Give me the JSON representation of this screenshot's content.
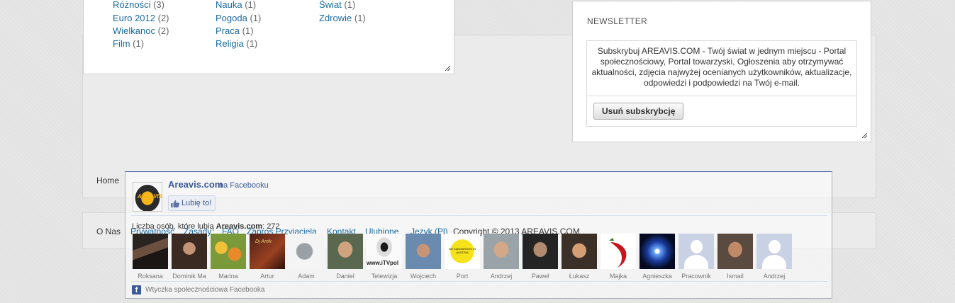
{
  "tags": [
    {
      "label": "Różności",
      "count": "(3)"
    },
    {
      "label": "Euro 2012",
      "count": "(2)"
    },
    {
      "label": "Wielkanoc",
      "count": "(2)"
    },
    {
      "label": "Film",
      "count": "(1)"
    },
    {
      "label": "Nauka",
      "count": "(1)"
    },
    {
      "label": "Pogoda",
      "count": "(1)"
    },
    {
      "label": "Praca",
      "count": "(1)"
    },
    {
      "label": "Religia",
      "count": "(1)"
    },
    {
      "label": "Świat",
      "count": "(1)"
    },
    {
      "label": "Zdrowie",
      "count": "(1)"
    }
  ],
  "newsletter": {
    "title": "NEWSLETTER",
    "text": "Subskrybuj AREAVIS.COM - Twój świat w jednym miejscu - Portal społecznościowy, Portal towarzyski, Ogłoszenia aby otrzymywać aktualności, zdjęcia najwyżej ocenianych użytkowników, aktualizacje, odpowiedzi i podpowiedzi na Twój e-mail.",
    "button": "Usuń subskrybcję"
  },
  "footer": {
    "home": "Home",
    "onas": "O Nas",
    "nav": [
      "Prywatność",
      "Zasady",
      "FAQ",
      "Zaproś Przyjaciela",
      "Kontakt",
      "Ulubione",
      "Język (Pl)"
    ],
    "copyright": "Copyright © 2013 AREAVIS.COM"
  },
  "facebook": {
    "logo_text": "AREAVIS",
    "page_name": "Areavis.com",
    "on_facebook": "na Facebooku",
    "like_label": "Lubię to!",
    "count_prefix": "Liczba osób, które lubią",
    "count_page": "Areavis.com",
    "count_value": ": 272",
    "fans": [
      "Roksana",
      "Dominik Ma",
      "Marina",
      "Artur",
      "Adam",
      "Daniel",
      "Telewizja",
      "Wojciech",
      "Port",
      "Andrzej",
      "Paweł",
      "Łukasz",
      "Majka",
      "Agnieszka",
      "Pracownik",
      "Ismail",
      "Andrzej"
    ],
    "fan_thumb_texts": {
      "artur": "Dj Arek",
      "telewizja": "www.iTVpol",
      "port": "NO KANGAROOS IN AUSTRIA"
    },
    "plugin_label": "Wtyczka społecznościowa Facebooka",
    "brand_color": "#3b5998"
  }
}
